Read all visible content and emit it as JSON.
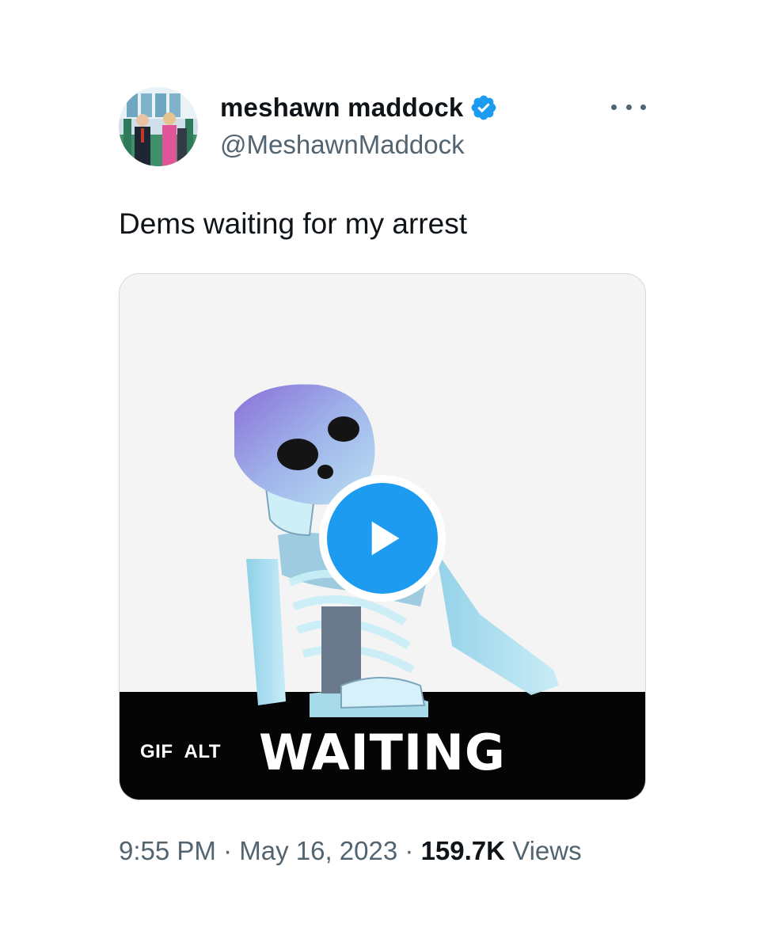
{
  "author": {
    "display_name": "meshawn maddock",
    "handle": "@MeshawnMaddock",
    "verified": true,
    "verified_color": "#1d9bf0",
    "avatar_icon": "profile-avatar"
  },
  "more_icon": "ellipsis-icon",
  "tweet": {
    "text": "Dems waiting for my arrest"
  },
  "media": {
    "type_badge": "GIF",
    "alt_badge": "ALT",
    "caption": "WAITING",
    "play_icon": "play-icon",
    "accent_color": "#1d9bf0"
  },
  "meta": {
    "time": "9:55 PM",
    "separator": "·",
    "date": "May 16, 2023",
    "views_count": "159.7K",
    "views_label": "Views"
  }
}
